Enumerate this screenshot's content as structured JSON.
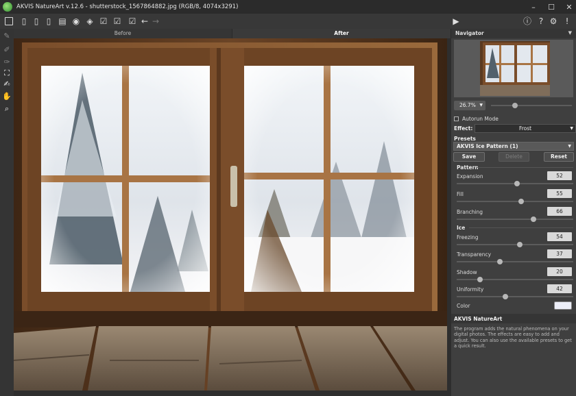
{
  "window": {
    "title": "AKVIS NatureArt v.12.6 - shutterstock_1567864882.jpg (RGB/8, 4074x3291)",
    "controls": [
      "minimize-icon",
      "maximize-icon",
      "close-icon"
    ]
  },
  "toolbar": {
    "left_icons": [
      "home-icon",
      "open-file-icon",
      "save-file-icon",
      "export-icon",
      "print-icon",
      "batch-icon",
      "share-icon",
      "before-after-icon",
      "apply-icon",
      "settings-brush-icon",
      "undo-icon",
      "redo-icon"
    ],
    "right_icons": [
      "run-icon",
      "info-icon",
      "help-icon",
      "gear-icon",
      "notification-icon"
    ]
  },
  "tools": [
    "brush-icon",
    "eraser-icon",
    "history-brush-icon",
    "crop-icon",
    "frost-brush-icon",
    "hand-icon",
    "zoom-icon"
  ],
  "view_tabs": [
    {
      "label": "Before",
      "active": false
    },
    {
      "label": "After",
      "active": true
    }
  ],
  "navigator": {
    "title": "Navigator",
    "zoom": "26.7%",
    "zoom_slider_fraction": 0.3
  },
  "autorun": {
    "label": "Autorun Mode",
    "checked": false
  },
  "effect": {
    "label": "Effect:",
    "value": "Frost"
  },
  "presets": {
    "label": "Presets",
    "selected": "AKVIS Ice Pattern (1)",
    "buttons": [
      {
        "label": "Save",
        "enabled": true
      },
      {
        "label": "Delete",
        "enabled": false
      },
      {
        "label": "Reset",
        "enabled": true
      }
    ]
  },
  "pattern": {
    "label": "Pattern",
    "params": [
      {
        "name": "Expansion",
        "value": 52
      },
      {
        "name": "Fill",
        "value": 55
      },
      {
        "name": "Branching",
        "value": 66
      }
    ]
  },
  "ice": {
    "label": "Ice",
    "params": [
      {
        "name": "Freezing",
        "value": 54
      },
      {
        "name": "Transparency",
        "value": 37
      },
      {
        "name": "Shadow",
        "value": 20
      },
      {
        "name": "Uniformity",
        "value": 42
      }
    ]
  },
  "color": {
    "label": "Color",
    "value": "#eceef8"
  },
  "help": {
    "title": "AKVIS NatureArt",
    "text": "The program adds the natural phenomena on your digital photos. The effects are easy to add and adjust. You can also use the available presets to get a quick result."
  }
}
